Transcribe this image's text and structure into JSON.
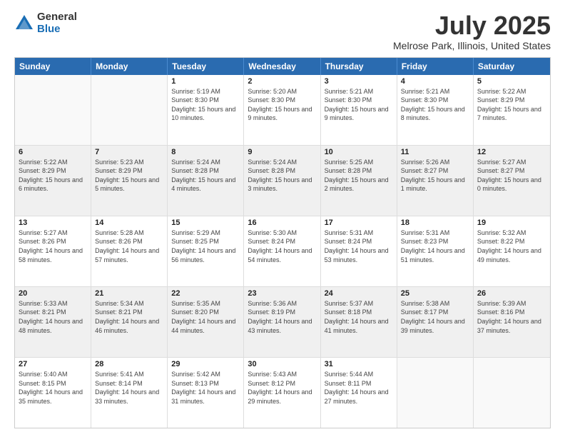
{
  "header": {
    "logo": {
      "general": "General",
      "blue": "Blue"
    },
    "title": "July 2025",
    "location": "Melrose Park, Illinois, United States"
  },
  "weekdays": [
    "Sunday",
    "Monday",
    "Tuesday",
    "Wednesday",
    "Thursday",
    "Friday",
    "Saturday"
  ],
  "weeks": [
    [
      {
        "day": "",
        "info": "",
        "empty": true
      },
      {
        "day": "",
        "info": "",
        "empty": true
      },
      {
        "day": "1",
        "info": "Sunrise: 5:19 AM\nSunset: 8:30 PM\nDaylight: 15 hours and 10 minutes."
      },
      {
        "day": "2",
        "info": "Sunrise: 5:20 AM\nSunset: 8:30 PM\nDaylight: 15 hours and 9 minutes."
      },
      {
        "day": "3",
        "info": "Sunrise: 5:21 AM\nSunset: 8:30 PM\nDaylight: 15 hours and 9 minutes."
      },
      {
        "day": "4",
        "info": "Sunrise: 5:21 AM\nSunset: 8:30 PM\nDaylight: 15 hours and 8 minutes."
      },
      {
        "day": "5",
        "info": "Sunrise: 5:22 AM\nSunset: 8:29 PM\nDaylight: 15 hours and 7 minutes."
      }
    ],
    [
      {
        "day": "6",
        "info": "Sunrise: 5:22 AM\nSunset: 8:29 PM\nDaylight: 15 hours and 6 minutes."
      },
      {
        "day": "7",
        "info": "Sunrise: 5:23 AM\nSunset: 8:29 PM\nDaylight: 15 hours and 5 minutes."
      },
      {
        "day": "8",
        "info": "Sunrise: 5:24 AM\nSunset: 8:28 PM\nDaylight: 15 hours and 4 minutes."
      },
      {
        "day": "9",
        "info": "Sunrise: 5:24 AM\nSunset: 8:28 PM\nDaylight: 15 hours and 3 minutes."
      },
      {
        "day": "10",
        "info": "Sunrise: 5:25 AM\nSunset: 8:28 PM\nDaylight: 15 hours and 2 minutes."
      },
      {
        "day": "11",
        "info": "Sunrise: 5:26 AM\nSunset: 8:27 PM\nDaylight: 15 hours and 1 minute."
      },
      {
        "day": "12",
        "info": "Sunrise: 5:27 AM\nSunset: 8:27 PM\nDaylight: 15 hours and 0 minutes."
      }
    ],
    [
      {
        "day": "13",
        "info": "Sunrise: 5:27 AM\nSunset: 8:26 PM\nDaylight: 14 hours and 58 minutes."
      },
      {
        "day": "14",
        "info": "Sunrise: 5:28 AM\nSunset: 8:26 PM\nDaylight: 14 hours and 57 minutes."
      },
      {
        "day": "15",
        "info": "Sunrise: 5:29 AM\nSunset: 8:25 PM\nDaylight: 14 hours and 56 minutes."
      },
      {
        "day": "16",
        "info": "Sunrise: 5:30 AM\nSunset: 8:24 PM\nDaylight: 14 hours and 54 minutes."
      },
      {
        "day": "17",
        "info": "Sunrise: 5:31 AM\nSunset: 8:24 PM\nDaylight: 14 hours and 53 minutes."
      },
      {
        "day": "18",
        "info": "Sunrise: 5:31 AM\nSunset: 8:23 PM\nDaylight: 14 hours and 51 minutes."
      },
      {
        "day": "19",
        "info": "Sunrise: 5:32 AM\nSunset: 8:22 PM\nDaylight: 14 hours and 49 minutes."
      }
    ],
    [
      {
        "day": "20",
        "info": "Sunrise: 5:33 AM\nSunset: 8:21 PM\nDaylight: 14 hours and 48 minutes."
      },
      {
        "day": "21",
        "info": "Sunrise: 5:34 AM\nSunset: 8:21 PM\nDaylight: 14 hours and 46 minutes."
      },
      {
        "day": "22",
        "info": "Sunrise: 5:35 AM\nSunset: 8:20 PM\nDaylight: 14 hours and 44 minutes."
      },
      {
        "day": "23",
        "info": "Sunrise: 5:36 AM\nSunset: 8:19 PM\nDaylight: 14 hours and 43 minutes."
      },
      {
        "day": "24",
        "info": "Sunrise: 5:37 AM\nSunset: 8:18 PM\nDaylight: 14 hours and 41 minutes."
      },
      {
        "day": "25",
        "info": "Sunrise: 5:38 AM\nSunset: 8:17 PM\nDaylight: 14 hours and 39 minutes."
      },
      {
        "day": "26",
        "info": "Sunrise: 5:39 AM\nSunset: 8:16 PM\nDaylight: 14 hours and 37 minutes."
      }
    ],
    [
      {
        "day": "27",
        "info": "Sunrise: 5:40 AM\nSunset: 8:15 PM\nDaylight: 14 hours and 35 minutes."
      },
      {
        "day": "28",
        "info": "Sunrise: 5:41 AM\nSunset: 8:14 PM\nDaylight: 14 hours and 33 minutes."
      },
      {
        "day": "29",
        "info": "Sunrise: 5:42 AM\nSunset: 8:13 PM\nDaylight: 14 hours and 31 minutes."
      },
      {
        "day": "30",
        "info": "Sunrise: 5:43 AM\nSunset: 8:12 PM\nDaylight: 14 hours and 29 minutes."
      },
      {
        "day": "31",
        "info": "Sunrise: 5:44 AM\nSunset: 8:11 PM\nDaylight: 14 hours and 27 minutes."
      },
      {
        "day": "",
        "info": "",
        "empty": true
      },
      {
        "day": "",
        "info": "",
        "empty": true
      }
    ]
  ]
}
